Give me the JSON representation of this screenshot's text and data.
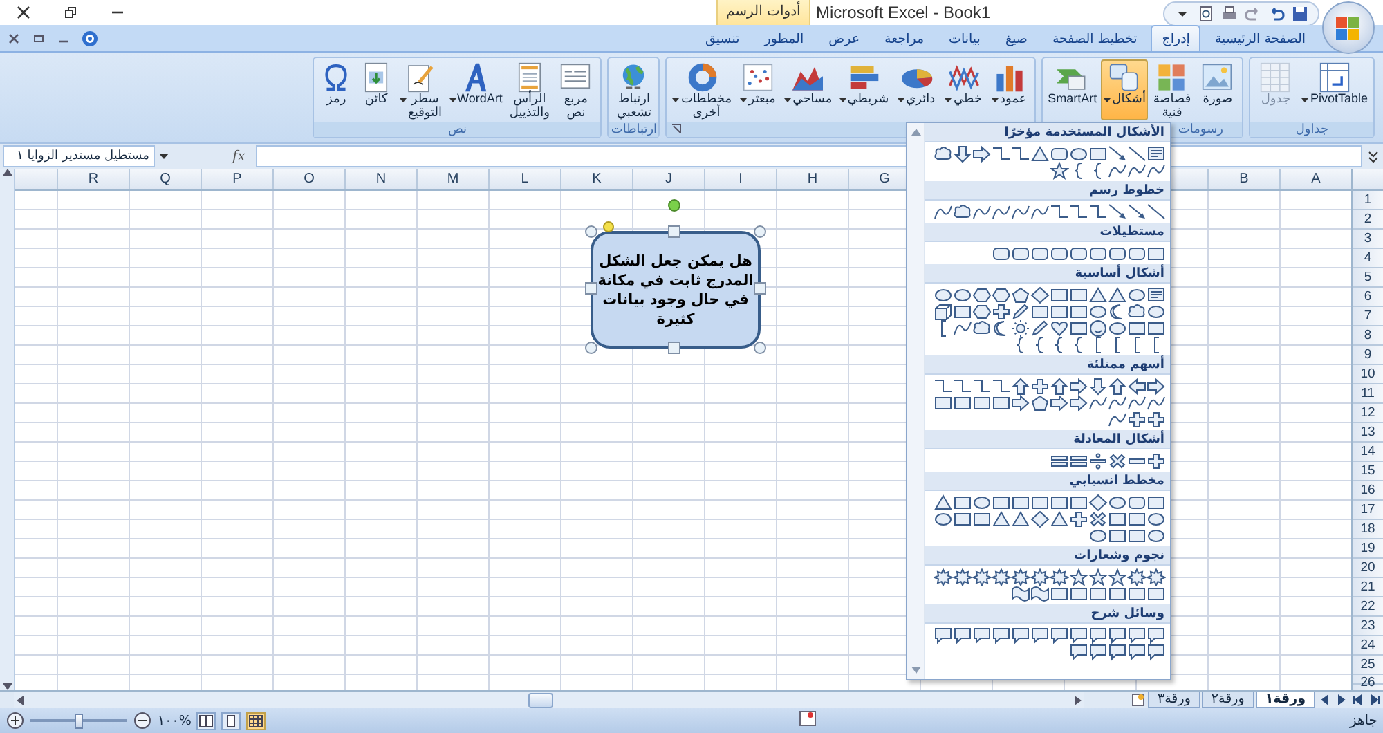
{
  "window": {
    "title": "Microsoft Excel - Book1",
    "contextual_tab": "أدوات الرسم"
  },
  "tabs": [
    {
      "label": "الصفحة الرئيسية",
      "selected": false
    },
    {
      "label": "إدراج",
      "selected": true
    },
    {
      "label": "تخطيط الصفحة",
      "selected": false
    },
    {
      "label": "صيغ",
      "selected": false
    },
    {
      "label": "بيانات",
      "selected": false
    },
    {
      "label": "مراجعة",
      "selected": false
    },
    {
      "label": "عرض",
      "selected": false
    },
    {
      "label": "المطور",
      "selected": false
    },
    {
      "label": "تنسيق",
      "selected": false
    }
  ],
  "ribbon": {
    "groups": [
      {
        "label": "جداول",
        "launcher": false,
        "buttons": [
          {
            "kind": "pivot-table",
            "label": "PivotTable",
            "dropdown": true,
            "disabled": false,
            "selected": false
          },
          {
            "kind": "table",
            "label": "جدول",
            "dropdown": false,
            "disabled": true,
            "selected": false
          }
        ]
      },
      {
        "label": "رسومات",
        "launcher": false,
        "buttons": [
          {
            "kind": "picture",
            "label": "صورة",
            "dropdown": false,
            "disabled": false,
            "selected": false
          },
          {
            "kind": "clip-art",
            "label": "قصاصة\nفنية",
            "dropdown": false,
            "disabled": false,
            "selected": false
          },
          {
            "kind": "shapes",
            "label": "أشكال",
            "dropdown": true,
            "disabled": false,
            "selected": true
          },
          {
            "kind": "smartart",
            "label": "SmartArt",
            "dropdown": false,
            "disabled": false,
            "selected": false
          }
        ]
      },
      {
        "launcher": true,
        "buttons": [
          {
            "kind": "column",
            "label": "عمود",
            "dropdown": true,
            "disabled": false,
            "selected": false
          },
          {
            "kind": "line",
            "label": "خطي",
            "dropdown": true,
            "disabled": false,
            "selected": false
          },
          {
            "kind": "pie",
            "label": "دائري",
            "dropdown": true,
            "disabled": false,
            "selected": false
          },
          {
            "kind": "bar",
            "label": "شريطي",
            "dropdown": true,
            "disabled": false,
            "selected": false
          },
          {
            "kind": "area",
            "label": "مساحي",
            "dropdown": true,
            "disabled": false,
            "selected": false
          },
          {
            "kind": "scatter",
            "label": "مبعثر",
            "dropdown": true,
            "disabled": false,
            "selected": false
          },
          {
            "kind": "other-charts",
            "label": "مخططات\nأخرى",
            "dropdown": true,
            "disabled": false,
            "selected": false
          }
        ]
      },
      {
        "label": "ارتباطات",
        "launcher": false,
        "buttons": [
          {
            "kind": "hyperlink",
            "label": "ارتباط\nتشعبي",
            "dropdown": false,
            "disabled": false,
            "selected": false
          }
        ]
      },
      {
        "label": "نص",
        "launcher": false,
        "buttons": [
          {
            "kind": "text-box",
            "label": "مربع\nنص",
            "dropdown": false,
            "disabled": false,
            "selected": false
          },
          {
            "kind": "header-footer",
            "label": "الرأس\nوالتذييل",
            "dropdown": false,
            "disabled": false,
            "selected": false
          },
          {
            "kind": "wordart",
            "label": "WordArt",
            "dropdown": true,
            "disabled": false,
            "selected": false
          },
          {
            "kind": "signature",
            "label": "سطر\nالتوقيع",
            "dropdown": true,
            "disabled": false,
            "selected": false
          },
          {
            "kind": "object",
            "label": "كائن",
            "dropdown": false,
            "disabled": false,
            "selected": false
          },
          {
            "kind": "symbol",
            "label": "رمز",
            "dropdown": false,
            "disabled": false,
            "selected": false
          }
        ]
      }
    ]
  },
  "formula_bar": {
    "name_box": "مستطيل مستدير الزوايا ١",
    "fx": "fx"
  },
  "sheet": {
    "column_headers": [
      "A",
      "B",
      "G",
      "H",
      "I",
      "J",
      "K",
      "L",
      "M",
      "N",
      "O",
      "P",
      "Q",
      "R"
    ],
    "row_headers": [
      "1",
      "2",
      "3",
      "4",
      "5",
      "6",
      "7",
      "8",
      "9",
      "10",
      "11",
      "12",
      "13",
      "14",
      "15",
      "16",
      "17",
      "18",
      "19",
      "20",
      "21",
      "22",
      "23",
      "24",
      "25",
      "26"
    ]
  },
  "shape": {
    "lines": [
      "هل يمكن جعل الشكل",
      "المدرج ثابت في مكانة",
      "في حال وجود بيانات",
      "كثيرة"
    ]
  },
  "shapes_gallery": {
    "sections": [
      {
        "title": "الأشكال المستخدمة مؤخرًا"
      },
      {
        "title": "خطوط رسم"
      },
      {
        "title": "مستطيلات"
      },
      {
        "title": "أشكال أساسية"
      },
      {
        "title": "أسهم ممتلئة"
      },
      {
        "title": "أشكال المعادلة"
      },
      {
        "title": "مخطط انسيابي"
      },
      {
        "title": "نجوم وشعارات"
      },
      {
        "title": "وسائل شرح"
      }
    ]
  },
  "sheet_tabs": [
    {
      "label": "ورقة١",
      "selected": true
    },
    {
      "label": "ورقة٢",
      "selected": false
    },
    {
      "label": "ورقة٣",
      "selected": false
    }
  ],
  "status_bar": {
    "status": "جاهز",
    "zoom": "%١٠٠",
    "zoom_slider": {
      "level": 0.5
    },
    "view_buttons": [
      {
        "kind": "normal",
        "selected": true
      },
      {
        "kind": "page-layout",
        "selected": false
      },
      {
        "kind": "page-break",
        "selected": false
      }
    ]
  }
}
